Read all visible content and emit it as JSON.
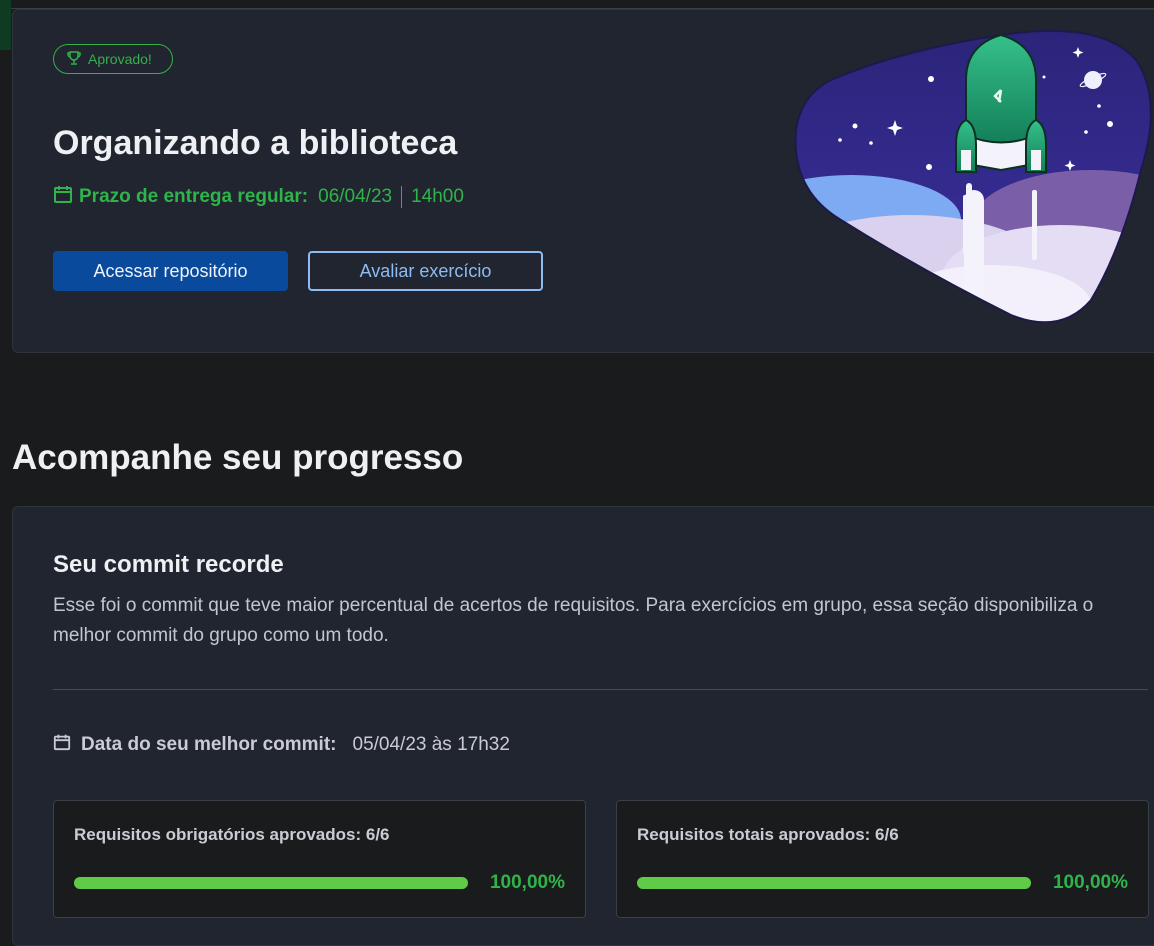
{
  "hero": {
    "badge": "Aprovado!",
    "title": "Organizando a biblioteca",
    "deadline_label": "Prazo de entrega regular:",
    "deadline_date": "06/04/23",
    "deadline_time": "14h00",
    "btn_repo": "Acessar repositório",
    "btn_eval": "Avaliar exercício"
  },
  "progress": {
    "section_title": "Acompanhe seu progresso",
    "card_title": "Seu commit recorde",
    "description": "Esse foi o commit que teve maior percentual de acertos de requisitos. Para exercícios em grupo, essa seção disponibiliza o melhor commit do grupo como um todo.",
    "best_commit_label": "Data do seu melhor commit:",
    "best_commit_value": "05/04/23 às 17h32",
    "requirements": [
      {
        "label": "Requisitos obrigatórios aprovados: 6/6",
        "percent_text": "100,00%",
        "fraction": 1.0
      },
      {
        "label": "Requisitos totais aprovados: 6/6",
        "percent_text": "100,00%",
        "fraction": 1.0
      }
    ]
  },
  "colors": {
    "accent_green": "#2fb34b",
    "primary_blue": "#0a4a9c",
    "outline_blue": "#8cbcf2",
    "progress_fill": "#5fcb47"
  },
  "icons": {
    "badge": "trophy-icon",
    "deadline": "calendar-icon",
    "best_commit": "calendar-icon"
  }
}
